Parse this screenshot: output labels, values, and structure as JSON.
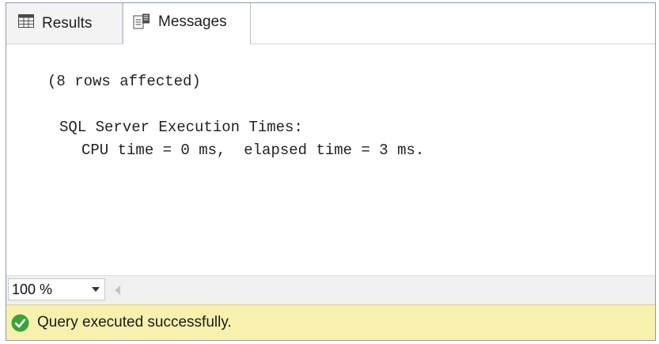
{
  "tabs": [
    {
      "label": "Results",
      "icon": "grid-icon",
      "active": false
    },
    {
      "label": "Messages",
      "icon": "messages-icon",
      "active": true
    }
  ],
  "messages": {
    "rows_affected": "(8 rows affected)",
    "exec_header": "SQL Server Execution Times:",
    "exec_detail": "CPU time = 0 ms,  elapsed time = 3 ms."
  },
  "zoom": {
    "value": "100 %",
    "dropdown_icon": "chevron-down-icon",
    "scroll_icon": "scroll-left-icon"
  },
  "status": {
    "icon": "check-circle-icon",
    "text": "Query executed successfully.",
    "color": "#f7f1ad",
    "icon_color": "#3aa43a"
  }
}
